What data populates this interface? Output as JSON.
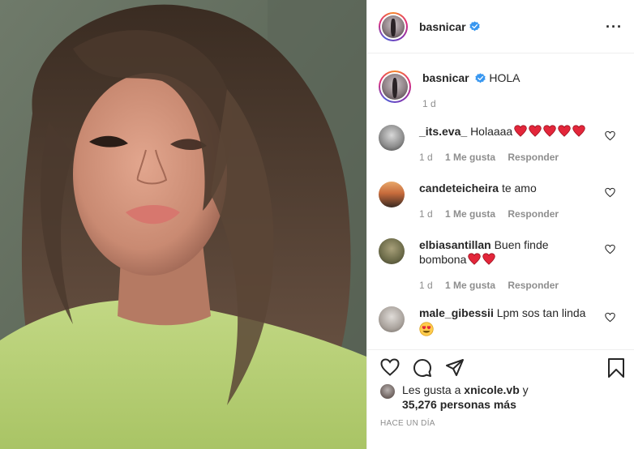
{
  "post": {
    "username": "basnicar",
    "more_icon": "more-horizontal-icon"
  },
  "caption": {
    "username": "basnicar",
    "text": "HOLA",
    "time": "1 d"
  },
  "comments": [
    {
      "username": "_its.eva_",
      "text": "Holaaaa",
      "hearts": 5,
      "time": "1 d",
      "likes": "1 Me gusta",
      "reply": "Responder"
    },
    {
      "username": "candeteicheira",
      "text": "te amo",
      "hearts": 0,
      "time": "1 d",
      "likes": "1 Me gusta",
      "reply": "Responder"
    },
    {
      "username": "elbiasantillan",
      "text": "Buen finde bombona",
      "hearts": 2,
      "time": "1 d",
      "likes": "1 Me gusta",
      "reply": "Responder"
    },
    {
      "username": "male_gibessii",
      "text": "Lpm sos tan linda",
      "emoji": "heart-eyes",
      "time": "",
      "likes": "",
      "reply": ""
    }
  ],
  "likes": {
    "prefix": "Les gusta a",
    "user": "xnicole.vb",
    "connector": "y",
    "count": "35,276 personas más"
  },
  "timeago": "HACE UN DÍA",
  "colors": {
    "verified": "#3897f0",
    "heart": "#ed4956",
    "muted": "#8e8e8e"
  }
}
